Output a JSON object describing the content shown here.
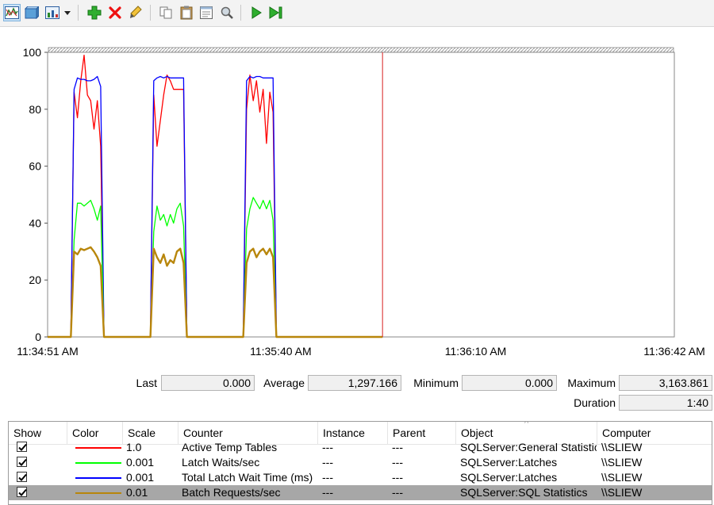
{
  "toolbar": {
    "buttons": [
      {
        "name": "view-graph-icon",
        "active": true
      },
      {
        "name": "view-histogram-icon",
        "active": false
      },
      {
        "name": "view-report-icon",
        "active": false
      },
      {
        "name": "dropdown-arrow-icon",
        "active": false
      },
      {
        "name": "add-counter-icon",
        "active": false
      },
      {
        "name": "delete-counter-icon",
        "active": false
      },
      {
        "name": "highlight-icon",
        "active": false
      },
      {
        "name": "copy-properties-icon",
        "active": false
      },
      {
        "name": "paste-counter-list-icon",
        "active": false
      },
      {
        "name": "properties-icon",
        "active": false
      },
      {
        "name": "zoom-icon",
        "active": false
      },
      {
        "name": "unfreeze-display-icon",
        "active": false
      },
      {
        "name": "update-data-icon",
        "active": false
      }
    ]
  },
  "chart_data": {
    "type": "line",
    "ylim": [
      0,
      100
    ],
    "yticks": [
      "0",
      "20",
      "40",
      "60",
      "80",
      "100"
    ],
    "xticks": [
      "11:34:51 AM",
      "11:35:40 AM",
      "11:36:10 AM",
      "11:36:42 AM"
    ],
    "grid": false,
    "series": [
      {
        "key": "active-temp-tables",
        "color": "#ff0000",
        "values": [
          0,
          0,
          0,
          0,
          0,
          0,
          0,
          0,
          86,
          77,
          90,
          99,
          85,
          83,
          73,
          83,
          67,
          0,
          0,
          0,
          0,
          0,
          0,
          0,
          0,
          0,
          0,
          0,
          0,
          0,
          0,
          0,
          85,
          67,
          76,
          85,
          92,
          90,
          87,
          87,
          87,
          87,
          0,
          0,
          0,
          0,
          0,
          0,
          0,
          0,
          0,
          0,
          0,
          0,
          0,
          0,
          0,
          0,
          0,
          0,
          80,
          92,
          83,
          90,
          79,
          87,
          68,
          86,
          79,
          0,
          0,
          0,
          0,
          0,
          0,
          0,
          0,
          0,
          0,
          0,
          0,
          0,
          0,
          0,
          0,
          0,
          0,
          0,
          0,
          0,
          0,
          0,
          0,
          0,
          0,
          0,
          0,
          0,
          0,
          0,
          0,
          0,
          0,
          0,
          0,
          0,
          0,
          0,
          0,
          0,
          0,
          0,
          0,
          0,
          0,
          0,
          0,
          0,
          0,
          0,
          0,
          0,
          0,
          0,
          0,
          0,
          0,
          0,
          0,
          0,
          0,
          0,
          0,
          0,
          0,
          0,
          0,
          0,
          0,
          0,
          0,
          0,
          0,
          0,
          0,
          0,
          0,
          0,
          0,
          0,
          0,
          0,
          0,
          0,
          0,
          0,
          0,
          0,
          0,
          0,
          0,
          0,
          0,
          0,
          0,
          0,
          0,
          0,
          0,
          0,
          0,
          0,
          0,
          0,
          0,
          0,
          0,
          0,
          0,
          0,
          0,
          0,
          0,
          0,
          0,
          0,
          0,
          0,
          0,
          0
        ]
      },
      {
        "key": "total-latch-wait-time",
        "color": "#0000ff",
        "values": [
          0,
          0,
          0,
          0,
          0,
          0,
          0,
          0,
          87,
          91,
          90.5,
          90.5,
          90,
          90,
          90.5,
          91.5,
          88,
          0,
          0,
          0,
          0,
          0,
          0,
          0,
          0,
          0,
          0,
          0,
          0,
          0,
          0,
          0,
          90,
          91,
          91.5,
          91,
          91.5,
          91,
          91,
          91,
          91,
          91,
          0,
          0,
          0,
          0,
          0,
          0,
          0,
          0,
          0,
          0,
          0,
          0,
          0,
          0,
          0,
          0,
          0,
          0,
          90,
          91.5,
          91,
          91.5,
          91.5,
          91,
          91,
          91,
          91,
          0,
          0,
          0,
          0,
          0,
          0,
          0,
          0,
          0,
          0,
          0,
          0,
          0,
          0,
          0,
          0,
          0,
          0,
          0,
          0,
          0,
          0,
          0,
          0,
          0,
          0,
          0,
          0,
          0,
          0,
          0,
          0,
          0,
          0,
          0,
          0,
          0,
          0,
          0,
          0,
          0,
          0,
          0,
          0,
          0,
          0,
          0,
          0,
          0,
          0,
          0,
          0,
          0,
          0,
          0,
          0,
          0,
          0,
          0,
          0,
          0,
          0,
          0,
          0,
          0,
          0,
          0,
          0,
          0,
          0,
          0,
          0,
          0,
          0,
          0,
          0,
          0,
          0,
          0,
          0,
          0,
          0,
          0,
          0,
          0,
          0,
          0,
          0,
          0,
          0,
          0,
          0,
          0,
          0,
          0,
          0,
          0,
          0,
          0,
          0,
          0,
          0,
          0,
          0,
          0,
          0,
          0,
          0,
          0,
          0,
          0,
          0,
          0,
          0,
          0,
          0,
          0,
          0,
          0,
          0,
          0,
          0,
          0,
          0,
          0
        ]
      },
      {
        "key": "latch-waits-sec",
        "color": "#00ff00",
        "values": [
          0,
          0,
          0,
          0,
          0,
          0,
          0,
          0,
          34,
          47,
          47,
          46,
          47,
          48,
          45,
          41,
          46,
          0,
          0,
          0,
          0,
          0,
          0,
          0,
          0,
          0,
          0,
          0,
          0,
          0,
          0,
          0,
          37,
          46,
          41,
          43,
          39,
          43,
          40,
          45,
          47,
          39,
          0,
          0,
          0,
          0,
          0,
          0,
          0,
          0,
          0,
          0,
          0,
          0,
          0,
          0,
          0,
          0,
          0,
          0,
          38,
          45,
          49,
          47,
          45,
          48,
          45,
          48,
          41,
          0,
          0,
          0,
          0,
          0,
          0,
          0,
          0,
          0,
          0,
          0,
          0,
          0,
          0,
          0,
          0,
          0,
          0,
          0,
          0,
          0,
          0,
          0,
          0,
          0,
          0,
          0,
          0,
          0,
          0,
          0,
          0,
          0,
          0,
          0,
          0,
          0,
          0,
          0,
          0,
          0,
          0,
          0,
          0,
          0,
          0,
          0,
          0,
          0,
          0,
          0,
          0,
          0,
          0,
          0,
          0,
          0,
          0,
          0,
          0,
          0,
          0,
          0,
          0,
          0,
          0,
          0,
          0,
          0,
          0,
          0,
          0,
          0,
          0,
          0,
          0,
          0,
          0,
          0,
          0,
          0,
          0,
          0,
          0,
          0,
          0,
          0,
          0,
          0,
          0,
          0,
          0,
          0,
          0,
          0,
          0,
          0,
          0,
          0,
          0,
          0,
          0,
          0,
          0,
          0,
          0,
          0,
          0,
          0,
          0,
          0,
          0,
          0,
          0,
          0,
          0,
          0
        ]
      },
      {
        "key": "batch-requests-sec",
        "color": "#b8860b",
        "values": [
          0,
          0,
          0,
          0,
          0,
          0,
          0,
          0,
          30,
          29,
          31,
          30.5,
          31,
          31.5,
          30,
          28,
          25,
          0,
          0,
          0,
          0,
          0,
          0,
          0,
          0,
          0,
          0,
          0,
          0,
          0,
          0,
          0,
          31,
          28,
          26,
          29,
          25,
          27,
          26,
          30,
          31,
          26,
          0,
          0,
          0,
          0,
          0,
          0,
          0,
          0,
          0,
          0,
          0,
          0,
          0,
          0,
          0,
          0,
          0,
          0,
          26,
          30,
          31,
          28,
          30,
          31,
          29,
          31,
          28,
          0,
          0,
          0,
          0,
          0,
          0,
          0,
          0,
          0,
          0,
          0,
          0,
          0,
          0,
          0,
          0,
          0,
          0,
          0,
          0,
          0,
          0,
          0,
          0,
          0,
          0,
          0,
          0,
          0,
          0,
          0,
          0,
          0,
          0,
          0,
          0,
          0,
          0,
          0,
          0,
          0,
          0,
          0,
          0,
          0,
          0,
          0,
          0,
          0,
          0,
          0,
          0,
          0,
          0,
          0,
          0,
          0,
          0,
          0,
          0,
          0,
          0,
          0,
          0,
          0,
          0,
          0,
          0,
          0,
          0,
          0,
          0,
          0,
          0,
          0,
          0,
          0,
          0,
          0,
          0,
          0,
          0,
          0,
          0,
          0,
          0,
          0,
          0,
          0,
          0,
          0,
          0,
          0,
          0,
          0,
          0,
          0,
          0,
          0,
          0,
          0,
          0,
          0,
          0,
          0,
          0,
          0,
          0,
          0,
          0,
          0,
          0,
          0,
          0,
          0,
          0,
          0,
          0
        ]
      }
    ],
    "visible_until_index": 101,
    "total_points": 190,
    "current_time_index": 101
  },
  "stats": {
    "last_label": "Last",
    "last_value": "0.000",
    "average_label": "Average",
    "average_value": "1,297.166",
    "minimum_label": "Minimum",
    "minimum_value": "0.000",
    "maximum_label": "Maximum",
    "maximum_value": "3,163.861",
    "duration_label": "Duration",
    "duration_value": "1:40"
  },
  "counter_list": {
    "headers": [
      "Show",
      "Color",
      "Scale",
      "Counter",
      "Instance",
      "Parent",
      "Object",
      "Computer"
    ],
    "sort_indicator": "^",
    "rows": [
      {
        "show": true,
        "color": "#ff0000",
        "scale": "1.0",
        "counter": "Active Temp Tables",
        "instance": "---",
        "parent": "---",
        "object": "SQLServer:General Statistics",
        "computer": "\\\\SLIEW",
        "selected": false
      },
      {
        "show": true,
        "color": "#00ff00",
        "scale": "0.001",
        "counter": "Latch Waits/sec",
        "instance": "---",
        "parent": "---",
        "object": "SQLServer:Latches",
        "computer": "\\\\SLIEW",
        "selected": false
      },
      {
        "show": true,
        "color": "#0000ff",
        "scale": "0.001",
        "counter": "Total Latch Wait Time (ms)",
        "instance": "---",
        "parent": "---",
        "object": "SQLServer:Latches",
        "computer": "\\\\SLIEW",
        "selected": false
      },
      {
        "show": true,
        "color": "#b8860b",
        "scale": "0.01",
        "counter": "Batch Requests/sec",
        "instance": "---",
        "parent": "---",
        "object": "SQLServer:SQL Statistics",
        "computer": "\\\\SLIEW",
        "selected": true
      }
    ]
  }
}
